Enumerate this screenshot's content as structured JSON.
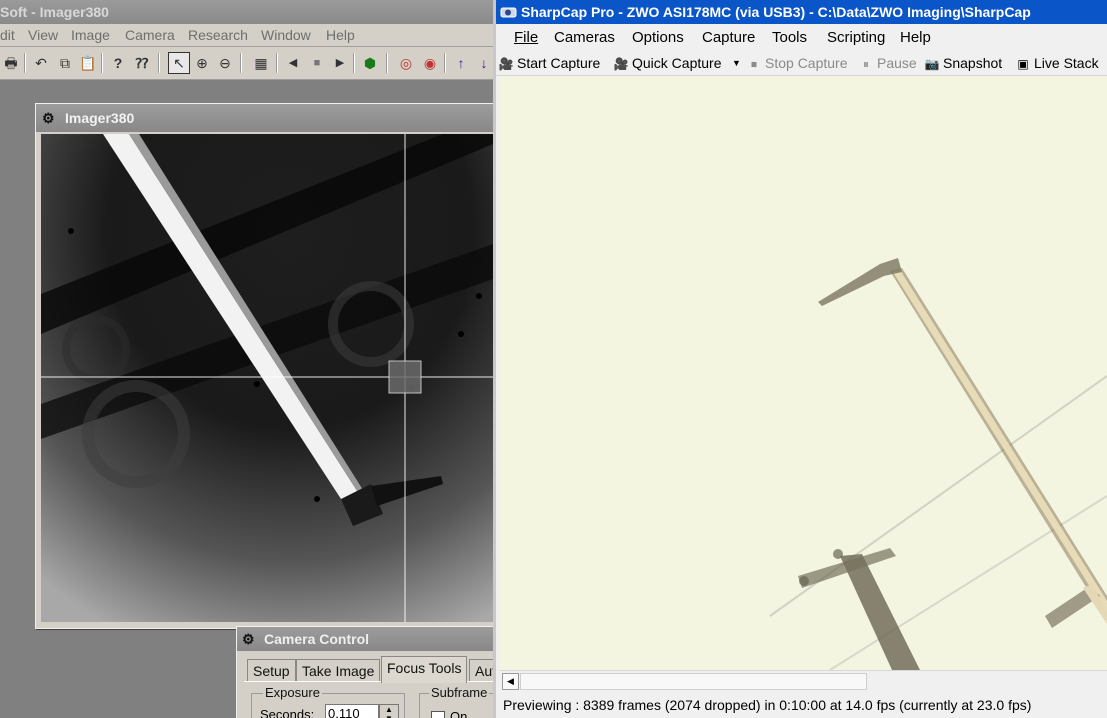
{
  "left_app": {
    "title": "Soft - Imager380",
    "menu": [
      "dit",
      "View",
      "Image",
      "Camera",
      "Research",
      "Window",
      "Help"
    ],
    "toolbar_icons": [
      "print-icon",
      "undo-icon",
      "copy-icon",
      "paste-icon",
      "help-icon",
      "context-help-icon",
      "pointer-icon",
      "zoom-in-icon",
      "zoom-out-icon",
      "tile-icon",
      "prev-icon",
      "stop-icon",
      "play-icon",
      "filter-icon",
      "color-icon",
      "color2-icon",
      "up-arrow-icon",
      "down-arrow-icon"
    ]
  },
  "imager_window": {
    "title": "Imager380"
  },
  "camera_control": {
    "title": "Camera Control",
    "tabs": [
      "Setup",
      "Take Image",
      "Focus Tools",
      "Aut"
    ],
    "active_tab": "Focus Tools",
    "exposure_group": "Exposure",
    "seconds_label": "Seconds:",
    "seconds_value": "0.110",
    "subframe_group": "Subframe",
    "subframe_on_label": "On"
  },
  "sharpcap": {
    "title": "SharpCap Pro - ZWO ASI178MC (via USB3) - C:\\Data\\ZWO Imaging\\SharpCap",
    "menu": [
      "File",
      "Cameras",
      "Options",
      "Capture",
      "Tools",
      "Scripting",
      "Help"
    ],
    "toolbar": {
      "start_capture": "Start Capture",
      "quick_capture": "Quick Capture",
      "stop_capture": "Stop Capture",
      "pause": "Pause",
      "snapshot": "Snapshot",
      "live_stack": "Live Stack"
    },
    "status": "Previewing : 8389 frames (2074 dropped) in 0:10:00 at 14.0 fps  (currently at 23.0 fps)"
  },
  "colors": {
    "sharpcap_titlebar": "#0a55c7",
    "inactive_titlebar": "#8c8c8c",
    "preview_bg": "#f3f5e1"
  }
}
